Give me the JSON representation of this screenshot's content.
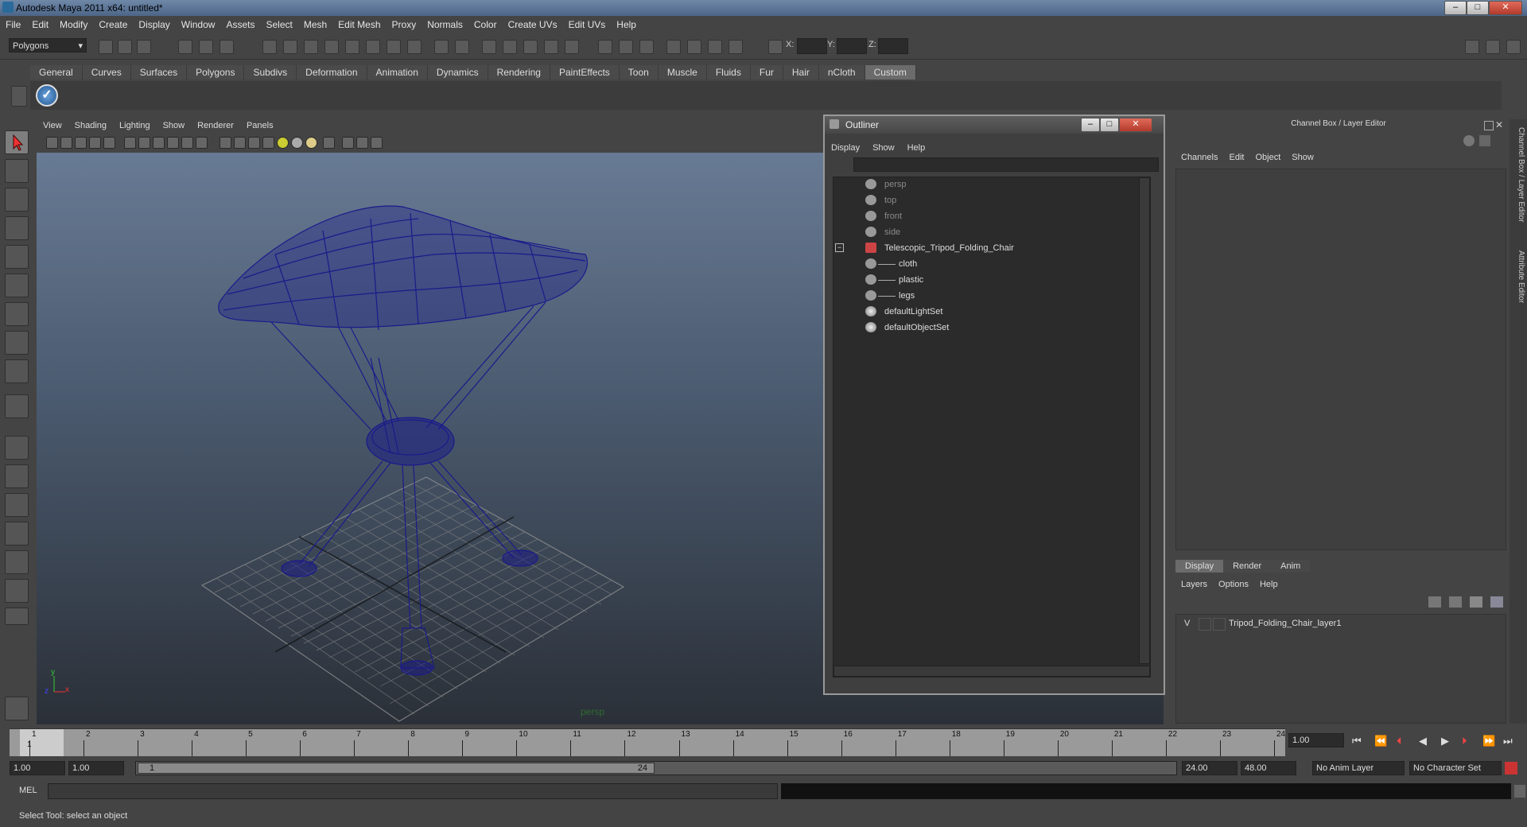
{
  "window": {
    "title": "Autodesk Maya 2011 x64: untitled*"
  },
  "menubar": [
    "File",
    "Edit",
    "Modify",
    "Create",
    "Display",
    "Window",
    "Assets",
    "Select",
    "Mesh",
    "Edit Mesh",
    "Proxy",
    "Normals",
    "Color",
    "Create UVs",
    "Edit UVs",
    "Help"
  ],
  "status": {
    "mode": "Polygons",
    "x_label": "X:",
    "y_label": "Y:",
    "z_label": "Z:"
  },
  "shelf_tabs": [
    "General",
    "Curves",
    "Surfaces",
    "Polygons",
    "Subdivs",
    "Deformation",
    "Animation",
    "Dynamics",
    "Rendering",
    "PaintEffects",
    "Toon",
    "Muscle",
    "Fluids",
    "Fur",
    "Hair",
    "nCloth",
    "Custom"
  ],
  "shelf_active": "Custom",
  "viewport": {
    "menu": [
      "View",
      "Shading",
      "Lighting",
      "Show",
      "Renderer",
      "Panels"
    ],
    "camera_label": "persp",
    "axis_y": "y",
    "axis_x": "x",
    "axis_z": "z"
  },
  "outliner": {
    "title": "Outliner",
    "menu": [
      "Display",
      "Show",
      "Help"
    ],
    "items": [
      {
        "label": "persp",
        "dim": true,
        "indent": 0,
        "icon": "camera-icon"
      },
      {
        "label": "top",
        "dim": true,
        "indent": 0,
        "icon": "camera-icon"
      },
      {
        "label": "front",
        "dim": true,
        "indent": 0,
        "icon": "camera-icon"
      },
      {
        "label": "side",
        "dim": true,
        "indent": 0,
        "icon": "camera-icon"
      },
      {
        "label": "Telescopic_Tripod_Folding_Chair",
        "dim": false,
        "indent": 0,
        "icon": "group-icon"
      },
      {
        "label": "cloth",
        "dim": false,
        "indent": 1,
        "icon": "mesh-icon"
      },
      {
        "label": "plastic",
        "dim": false,
        "indent": 1,
        "icon": "mesh-icon"
      },
      {
        "label": "legs",
        "dim": false,
        "indent": 1,
        "icon": "mesh-icon"
      },
      {
        "label": "defaultLightSet",
        "dim": false,
        "indent": 0,
        "icon": "set-icon"
      },
      {
        "label": "defaultObjectSet",
        "dim": false,
        "indent": 0,
        "icon": "set-icon"
      }
    ]
  },
  "channel_box": {
    "title": "Channel Box / Layer Editor",
    "menu": [
      "Channels",
      "Edit",
      "Object",
      "Show"
    ],
    "layer_tabs": [
      "Display",
      "Render",
      "Anim"
    ],
    "layer_menu": [
      "Layers",
      "Options",
      "Help"
    ],
    "layer": {
      "visible": "V",
      "name": "Tripod_Folding_Chair_layer1"
    }
  },
  "side_tabs": [
    "Channel Box / Layer Editor",
    "Attribute Editor"
  ],
  "timeline": {
    "ticks": [
      "1",
      "2",
      "3",
      "4",
      "5",
      "6",
      "7",
      "8",
      "9",
      "10",
      "11",
      "12",
      "13",
      "14",
      "15",
      "16",
      "17",
      "18",
      "19",
      "20",
      "21",
      "22",
      "23",
      "24"
    ],
    "current_marker": "1",
    "current_frame": "1.00"
  },
  "range": {
    "start": "1.00",
    "playback_start": "1.00",
    "slider_start": "1",
    "slider_end": "24",
    "playback_end": "24.00",
    "end": "48.00",
    "anim_layer": "No Anim Layer",
    "char_set": "No Character Set"
  },
  "command": {
    "label": "MEL"
  },
  "help_line": "Select Tool: select an object",
  "colors": {
    "viewport_top": "#6c7f99",
    "viewport_bottom": "#2b3038",
    "wireframe": "#1a1a8a"
  }
}
